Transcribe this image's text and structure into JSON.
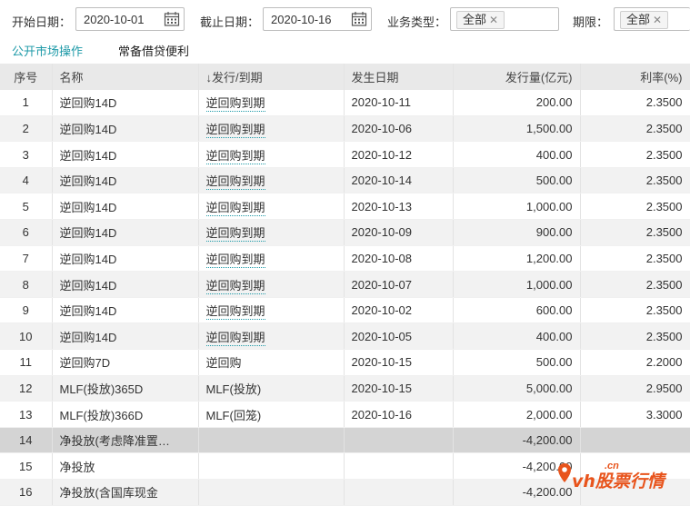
{
  "filters": {
    "start_label": "开始日期：",
    "start_value": "2020-10-01",
    "end_label": "截止日期：",
    "end_value": "2020-10-16",
    "type_label": "业务类型：",
    "type_chip": "全部",
    "term_label": "期限：",
    "term_chip": "全部"
  },
  "tabs": [
    "公开市场操作",
    "常备借贷便利"
  ],
  "table": {
    "headers": [
      "序号",
      "名称",
      "↓发行/到期",
      "发生日期",
      "发行量(亿元)",
      "利率(%)"
    ],
    "rows": [
      [
        "1",
        "逆回购14D",
        "逆回购到期",
        "2020-10-11",
        "200.00",
        "2.3500"
      ],
      [
        "2",
        "逆回购14D",
        "逆回购到期",
        "2020-10-06",
        "1,500.00",
        "2.3500"
      ],
      [
        "3",
        "逆回购14D",
        "逆回购到期",
        "2020-10-12",
        "400.00",
        "2.3500"
      ],
      [
        "4",
        "逆回购14D",
        "逆回购到期",
        "2020-10-14",
        "500.00",
        "2.3500"
      ],
      [
        "5",
        "逆回购14D",
        "逆回购到期",
        "2020-10-13",
        "1,000.00",
        "2.3500"
      ],
      [
        "6",
        "逆回购14D",
        "逆回购到期",
        "2020-10-09",
        "900.00",
        "2.3500"
      ],
      [
        "7",
        "逆回购14D",
        "逆回购到期",
        "2020-10-08",
        "1,200.00",
        "2.3500"
      ],
      [
        "8",
        "逆回购14D",
        "逆回购到期",
        "2020-10-07",
        "1,000.00",
        "2.3500"
      ],
      [
        "9",
        "逆回购14D",
        "逆回购到期",
        "2020-10-02",
        "600.00",
        "2.3500"
      ],
      [
        "10",
        "逆回购14D",
        "逆回购到期",
        "2020-10-05",
        "400.00",
        "2.3500"
      ],
      [
        "11",
        "逆回购7D",
        "逆回购",
        "2020-10-15",
        "500.00",
        "2.2000"
      ],
      [
        "12",
        "MLF(投放)365D",
        "MLF(投放)",
        "2020-10-15",
        "5,000.00",
        "2.9500"
      ],
      [
        "13",
        "MLF(投放)366D",
        "MLF(回笼)",
        "2020-10-16",
        "2,000.00",
        "3.3000"
      ],
      [
        "14",
        "净投放(考虑降准置…",
        "",
        "",
        "-4,200.00",
        ""
      ],
      [
        "15",
        "净投放",
        "",
        "",
        "-4,200.00",
        ""
      ],
      [
        "16",
        "净投放(含国库现金",
        "",
        "",
        "-4,200.00",
        ""
      ]
    ]
  },
  "watermark": {
    "text": "vh股票行情",
    "domain": ".cn"
  },
  "colors": {
    "accent": "#1e9aa8",
    "watermark": "#e8541c",
    "header_bg": "#e9e9e9",
    "highlight_row": "#d4d4d4"
  }
}
